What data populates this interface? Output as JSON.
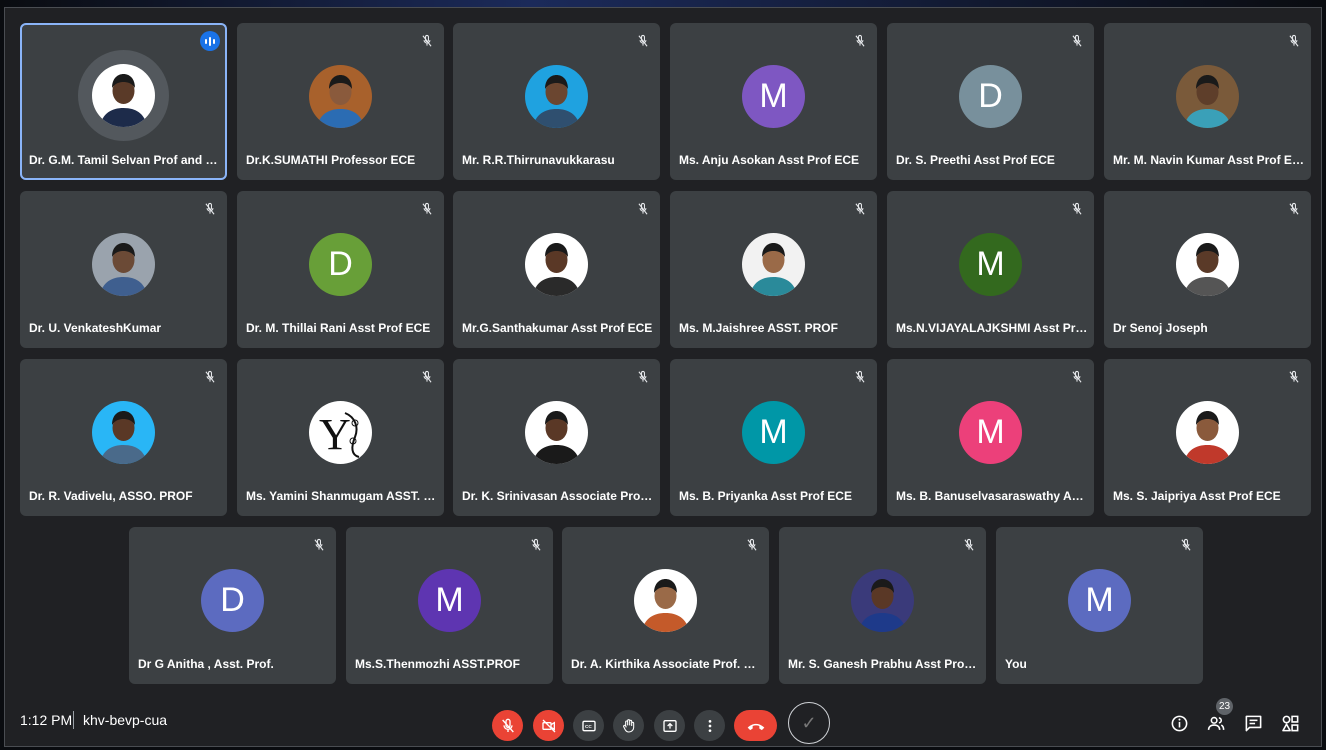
{
  "participants": [
    {
      "name": "Dr. G.M. Tamil Selvan Prof and Head",
      "avatar": "photo",
      "photo_bg": "#ffffff",
      "skin": "#5a3a28",
      "shirt": "#1d2b4a",
      "speaking": true
    },
    {
      "name": "Dr.K.SUMATHI Professor ECE",
      "avatar": "photo",
      "photo_bg": "#a8612c",
      "skin": "#8a5a3c",
      "shirt": "#2b6cb3",
      "muted": true
    },
    {
      "name": "Mr. R.R.Thirrunavukkarasu",
      "avatar": "photo",
      "photo_bg": "#1fa2e0",
      "skin": "#6b4630",
      "shirt": "#2f4f6f",
      "muted": true
    },
    {
      "name": "Ms. Anju Asokan Asst Prof ECE",
      "avatar": "letter",
      "letter": "M",
      "color": "#7e57c2",
      "muted": true
    },
    {
      "name": "Dr. S. Preethi Asst Prof ECE",
      "avatar": "letter",
      "letter": "D",
      "color": "#78909c",
      "muted": true
    },
    {
      "name": "Mr. M. Navin Kumar Asst Prof ECE",
      "avatar": "photo",
      "photo_bg": "#7a5a3a",
      "skin": "#5e3e2a",
      "shirt": "#3aa0b8",
      "muted": true
    },
    {
      "name": "Dr. U. VenkateshKumar",
      "avatar": "photo",
      "photo_bg": "#9aa3ad",
      "skin": "#6b4a36",
      "shirt": "#3f5f8f",
      "muted": true
    },
    {
      "name": "Dr. M. Thillai Rani Asst Prof ECE",
      "avatar": "letter",
      "letter": "D",
      "color": "#689f38",
      "muted": true
    },
    {
      "name": "Mr.G.Santhakumar Asst Prof ECE",
      "avatar": "photo",
      "photo_bg": "#ffffff",
      "skin": "#5a3826",
      "shirt": "#2a2a2a",
      "muted": true
    },
    {
      "name": "Ms. M.Jaishree ASST. PROF",
      "avatar": "photo",
      "photo_bg": "#f2f2f2",
      "skin": "#9a6a48",
      "shirt": "#2a8a9a",
      "muted": true
    },
    {
      "name": "Ms.N.VIJAYALAJKSHMI Asst Prof ECE",
      "avatar": "letter",
      "letter": "M",
      "color": "#33691e",
      "muted": true
    },
    {
      "name": "Dr Senoj Joseph",
      "avatar": "photo",
      "photo_bg": "#ffffff",
      "skin": "#5a3a28",
      "shirt": "#555555",
      "muted": true
    },
    {
      "name": "Dr. R. Vadivelu, ASSO. PROF",
      "avatar": "photo",
      "photo_bg": "#29b6f6",
      "skin": "#5a3826",
      "shirt": "#4a6a8a",
      "muted": true
    },
    {
      "name": "Ms. Yamini Shanmugam ASST. PROF",
      "avatar": "logo",
      "logo_text": "Y",
      "muted": true
    },
    {
      "name": "Dr. K. Srinivasan Associate Professor",
      "avatar": "photo",
      "photo_bg": "#ffffff",
      "skin": "#5a3826",
      "shirt": "#1a1a1a",
      "muted": true
    },
    {
      "name": "Ms. B. Priyanka Asst Prof ECE",
      "avatar": "letter",
      "letter": "M",
      "color": "#0097a7",
      "muted": true
    },
    {
      "name": "Ms. B. Banuselvasaraswathy Asst Prof ECE",
      "avatar": "letter",
      "letter": "M",
      "color": "#ec407a",
      "muted": true
    },
    {
      "name": "Ms. S. Jaipriya Asst Prof ECE",
      "avatar": "photo",
      "photo_bg": "#ffffff",
      "skin": "#8a5a3c",
      "shirt": "#c0392b",
      "muted": true
    },
    {
      "name": "Dr G Anitha , Asst. Prof.",
      "avatar": "letter",
      "letter": "D",
      "color": "#5c6bc0",
      "muted": true
    },
    {
      "name": "Ms.S.Thenmozhi ASST.PROF",
      "avatar": "letter",
      "letter": "M",
      "color": "#5e35b1",
      "muted": true
    },
    {
      "name": "Dr. A. Kirthika Associate Prof. ECE",
      "avatar": "photo",
      "photo_bg": "#ffffff",
      "skin": "#9a6a48",
      "shirt": "#c45a2a",
      "muted": true
    },
    {
      "name": "Mr. S. Ganesh Prabhu Asst Prof ECE",
      "avatar": "photo",
      "photo_bg": "#3a3a7a",
      "skin": "#5a3826",
      "shirt": "#1e3a8a",
      "muted": true
    },
    {
      "name": "You",
      "avatar": "letter",
      "letter": "M",
      "color": "#5c6bc0",
      "muted": true
    }
  ],
  "bottom_bar": {
    "time": "1:12 PM",
    "meeting_code": "khv-bevp-cua",
    "participant_count": "23"
  },
  "icons": {
    "mic": "mic-off-icon",
    "camera": "camera-off-icon",
    "captions": "captions-icon",
    "hand": "raise-hand-icon",
    "present": "present-icon",
    "more": "more-options-icon",
    "end": "end-call-icon",
    "info": "info-icon",
    "people": "people-icon",
    "chat": "chat-icon",
    "activities": "activities-icon"
  },
  "colors": {
    "accent_blue": "#8ab4f8",
    "speaking_badge": "#1a73e8",
    "danger": "#ea4335",
    "tile_bg": "#3c4043",
    "stage_bg": "#202124"
  }
}
